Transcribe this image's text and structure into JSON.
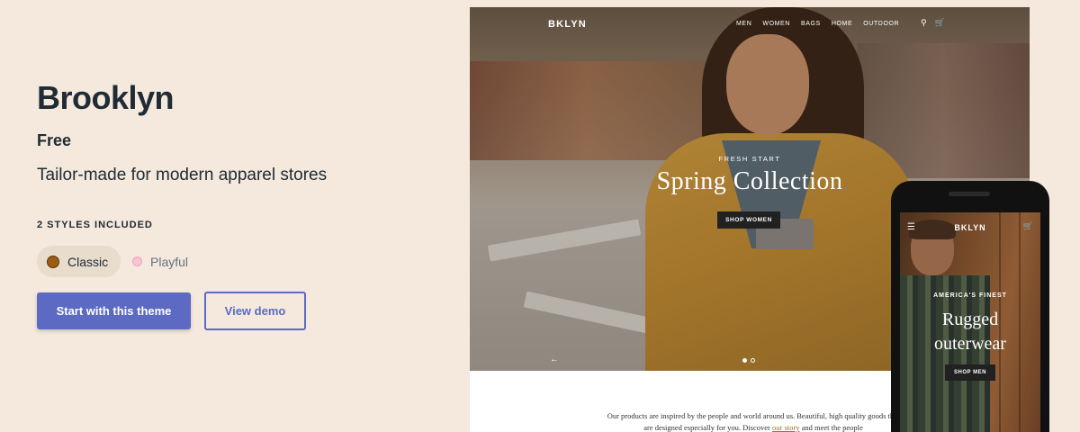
{
  "theme": {
    "name": "Brooklyn",
    "price": "Free",
    "tagline": "Tailor-made for modern apparel stores",
    "styles_heading": "2 STYLES INCLUDED",
    "styles": [
      {
        "label": "Classic",
        "color": "#9c5e12",
        "selected": true
      },
      {
        "label": "Playful",
        "color": "#f7c4d6",
        "selected": false
      }
    ],
    "primary_button": "Start with this theme",
    "secondary_button": "View demo",
    "accent_color": "#5c6ac4"
  },
  "desktop_preview": {
    "logo": "BKLYN",
    "nav": [
      "MEN",
      "WOMEN",
      "BAGS",
      "HOME",
      "OUTDOOR"
    ],
    "icons": [
      "search-icon",
      "cart-icon"
    ],
    "kicker": "FRESH START",
    "headline": "Spring Collection",
    "cta": "SHOP WOMEN",
    "prev_arrow": "←",
    "slides_count": 2,
    "active_slide": 1,
    "body_text_1": "Our products are inspired by the people and world around us. Beautiful, high quality goods that are designed especially for you. Discover",
    "body_link": "our story",
    "body_text_2": "and meet the people"
  },
  "mobile_preview": {
    "menu_icon": "☰",
    "logo": "BKLYN",
    "cart_icon": "🛒",
    "kicker": "AMERICA'S FINEST",
    "headline_line1": "Rugged",
    "headline_line2": "outerwear",
    "cta": "SHOP MEN"
  }
}
